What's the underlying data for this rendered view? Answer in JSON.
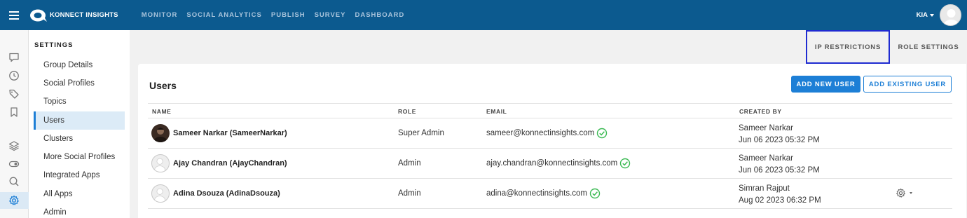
{
  "app": {
    "brand": "KONNECT INSIGHTS",
    "nav": [
      "MONITOR",
      "SOCIAL ANALYTICS",
      "PUBLISH",
      "SURVEY",
      "DASHBOARD"
    ],
    "user": "KIA",
    "colors": {
      "topbar": "#0c5a8f",
      "accent": "#1d7fd6",
      "verified": "#3cba54"
    }
  },
  "rail": {
    "icons": [
      "chat-icon",
      "clock-icon",
      "tag-icon",
      "bookmark-icon",
      "layers-icon",
      "toggle-icon",
      "search-icon",
      "gear-icon"
    ],
    "active": "gear-icon"
  },
  "settings": {
    "title": "SETTINGS",
    "items": [
      "Group Details",
      "Social Profiles",
      "Topics",
      "Users",
      "Clusters",
      "More Social Profiles",
      "Integrated Apps",
      "All Apps",
      "Admin"
    ],
    "active": "Users"
  },
  "tabs": {
    "ip": "IP RESTRICTIONS",
    "role": "ROLE SETTINGS"
  },
  "users": {
    "title": "Users",
    "add_new": "ADD NEW USER",
    "add_existing": "ADD EXISTING USER",
    "columns": {
      "name": "NAME",
      "role": "ROLE",
      "email": "EMAIL",
      "created_by": "CREATED BY"
    },
    "rows": [
      {
        "name": "Sameer Narkar (SameerNarkar)",
        "role": "Super Admin",
        "email": "sameer@konnectinsights.com",
        "created_by": "Sameer Narkar",
        "created_on": "Jun 06 2023 05:32 PM",
        "avatar": "photo"
      },
      {
        "name": "Ajay Chandran (AjayChandran)",
        "role": "Admin",
        "email": "ajay.chandran@konnectinsights.com",
        "created_by": "Sameer Narkar",
        "created_on": "Jun 06 2023 05:32 PM",
        "avatar": "blank"
      },
      {
        "name": "Adina Dsouza (AdinaDsouza)",
        "role": "Admin",
        "email": "adina@konnectinsights.com",
        "created_by": "Simran Rajput",
        "created_on": "Aug 02 2023 06:32 PM",
        "avatar": "blank"
      }
    ]
  }
}
